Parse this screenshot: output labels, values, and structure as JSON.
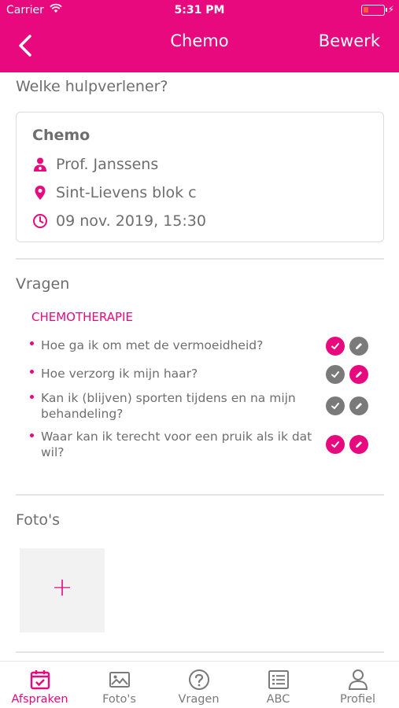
{
  "status_bar": {
    "carrier": "Carrier",
    "time": "5:31 PM"
  },
  "nav": {
    "title": "Chemo",
    "edit": "Bewerk"
  },
  "provider_section": {
    "heading": "Welke hulpverlener?",
    "card": {
      "title": "Chemo",
      "doctor": "Prof. Janssens",
      "location": "Sint-Lievens blok c",
      "datetime": "09 nov. 2019, 15:30"
    }
  },
  "questions_section": {
    "heading": "Vragen",
    "category": "CHEMOTHERAPIE",
    "items": [
      {
        "text": "Hoe ga ik om met de vermoeidheid?",
        "checked": true,
        "edited": false
      },
      {
        "text": "Hoe verzorg ik mijn haar?",
        "checked": false,
        "edited": true
      },
      {
        "text": "Kan ik (blijven) sporten tijdens en na mijn behandeling?",
        "checked": false,
        "edited": false
      },
      {
        "text": "Waar kan ik terecht voor een pruik als ik dat wil?",
        "checked": true,
        "edited": true
      }
    ]
  },
  "photos_section": {
    "heading": "Foto's",
    "add_symbol": "+"
  },
  "tabbar": {
    "items": [
      {
        "label": "Afspraken",
        "icon": "calendar-check-icon",
        "active": true
      },
      {
        "label": "Foto's",
        "icon": "image-icon",
        "active": false
      },
      {
        "label": "Vragen",
        "icon": "question-circle-icon",
        "active": false
      },
      {
        "label": "ABC",
        "icon": "list-icon",
        "active": false
      },
      {
        "label": "Profiel",
        "icon": "person-icon",
        "active": false
      }
    ]
  },
  "colors": {
    "accent": "#e8097f",
    "inactive_button": "#7a7a7a",
    "text": "#6e6e6e"
  }
}
